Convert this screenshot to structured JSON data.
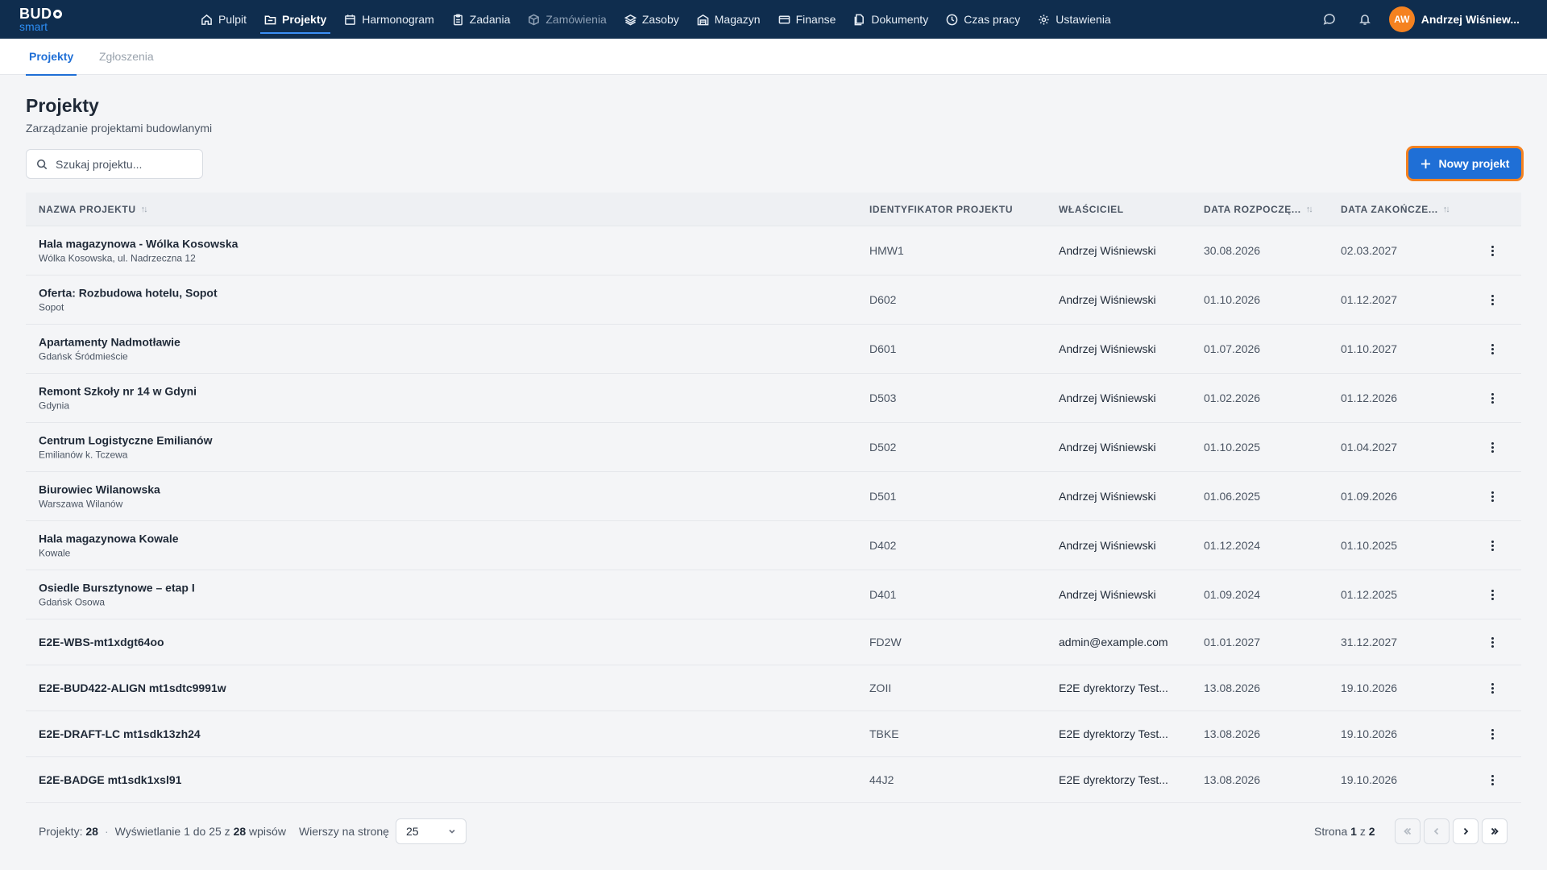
{
  "logo": {
    "line1": "BUD",
    "line2": "smart"
  },
  "nav": [
    {
      "label": "Pulpit",
      "icon": "home-icon"
    },
    {
      "label": "Projekty",
      "icon": "folder-icon"
    },
    {
      "label": "Harmonogram",
      "icon": "calendar-icon"
    },
    {
      "label": "Zadania",
      "icon": "clipboard-icon"
    },
    {
      "label": "Zamówienia",
      "icon": "package-icon"
    },
    {
      "label": "Zasoby",
      "icon": "layers-icon"
    },
    {
      "label": "Magazyn",
      "icon": "warehouse-icon"
    },
    {
      "label": "Finanse",
      "icon": "card-icon"
    },
    {
      "label": "Dokumenty",
      "icon": "documents-icon"
    },
    {
      "label": "Czas pracy",
      "icon": "clock-icon"
    },
    {
      "label": "Ustawienia",
      "icon": "gear-icon"
    }
  ],
  "user": {
    "initials": "AW",
    "name": "Andrzej Wiśniew..."
  },
  "subtabs": {
    "active": "Projekty",
    "inactive": "Zgłoszenia"
  },
  "header": {
    "title": "Projekty",
    "subtitle": "Zarządzanie projektami budowlanymi",
    "search_placeholder": "Szukaj projektu...",
    "new_button": "Nowy projekt"
  },
  "table": {
    "columns": {
      "name": "Nazwa projektu",
      "id": "Identyfikator projektu",
      "owner": "Właściciel",
      "start": "Data rozpoczę...",
      "end": "Data zakończe..."
    },
    "rows": [
      {
        "name": "Hala magazynowa - Wólka Kosowska",
        "location": "Wólka Kosowska, ul. Nadrzeczna 12",
        "id": "HMW1",
        "owner": "Andrzej Wiśniewski",
        "start": "30.08.2026",
        "end": "02.03.2027"
      },
      {
        "name": "Oferta: Rozbudowa hotelu, Sopot",
        "location": "Sopot",
        "id": "D602",
        "owner": "Andrzej Wiśniewski",
        "start": "01.10.2026",
        "end": "01.12.2027"
      },
      {
        "name": "Apartamenty Nadmotławie",
        "location": "Gdańsk Śródmieście",
        "id": "D601",
        "owner": "Andrzej Wiśniewski",
        "start": "01.07.2026",
        "end": "01.10.2027"
      },
      {
        "name": "Remont Szkoły nr 14 w Gdyni",
        "location": "Gdynia",
        "id": "D503",
        "owner": "Andrzej Wiśniewski",
        "start": "01.02.2026",
        "end": "01.12.2026"
      },
      {
        "name": "Centrum Logistyczne Emilianów",
        "location": "Emilianów k. Tczewa",
        "id": "D502",
        "owner": "Andrzej Wiśniewski",
        "start": "01.10.2025",
        "end": "01.04.2027"
      },
      {
        "name": "Biurowiec Wilanowska",
        "location": "Warszawa Wilanów",
        "id": "D501",
        "owner": "Andrzej Wiśniewski",
        "start": "01.06.2025",
        "end": "01.09.2026"
      },
      {
        "name": "Hala magazynowa Kowale",
        "location": "Kowale",
        "id": "D402",
        "owner": "Andrzej Wiśniewski",
        "start": "01.12.2024",
        "end": "01.10.2025"
      },
      {
        "name": "Osiedle Bursztynowe – etap I",
        "location": "Gdańsk Osowa",
        "id": "D401",
        "owner": "Andrzej Wiśniewski",
        "start": "01.09.2024",
        "end": "01.12.2025"
      },
      {
        "name": "E2E-WBS-mt1xdgt64oo",
        "location": "",
        "id": "FD2W",
        "owner": "admin@example.com",
        "start": "01.01.2027",
        "end": "31.12.2027"
      },
      {
        "name": "E2E-BUD422-ALIGN mt1sdtc9991w",
        "location": "",
        "id": "ZOII",
        "owner": "E2E dyrektorzy Test...",
        "start": "13.08.2026",
        "end": "19.10.2026"
      },
      {
        "name": "E2E-DRAFT-LC mt1sdk13zh24",
        "location": "",
        "id": "TBKE",
        "owner": "E2E dyrektorzy Test...",
        "start": "13.08.2026",
        "end": "19.10.2026"
      },
      {
        "name": "E2E-BADGE mt1sdk1xsl91",
        "location": "",
        "id": "44J2",
        "owner": "E2E dyrektorzy Test...",
        "start": "13.08.2026",
        "end": "19.10.2026"
      }
    ]
  },
  "footer": {
    "projects_label": "Projekty:",
    "projects_count": "28",
    "showing_prefix": "Wyświetlanie 1 do 25 z",
    "showing_total": "28",
    "showing_suffix": "wpisów",
    "rows_per_page_label": "Wierszy na stronę",
    "rows_per_page_value": "25",
    "page_label": "Strona",
    "page_current": "1",
    "page_of": "z",
    "page_total": "2"
  },
  "colors": {
    "topbar": "#0f2d4e",
    "accent": "#1f6fd6",
    "highlight": "#f58220"
  }
}
